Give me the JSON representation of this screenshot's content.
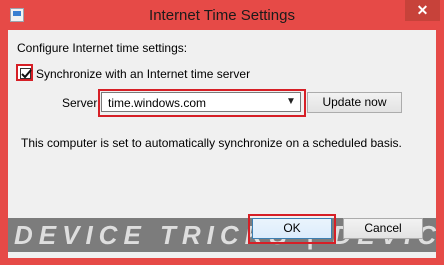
{
  "window": {
    "title": "Internet Time Settings",
    "close_glyph": "✕",
    "icon": "control-panel-icon"
  },
  "content": {
    "configure_label": "Configure Internet time settings:",
    "sync_checkbox": {
      "label": "Synchronize with an Internet time server",
      "checked": true
    },
    "server_label": "Server:",
    "server_value": "time.windows.com",
    "update_button": "Update now",
    "status_text": "This computer is set to automatically synchronize on a scheduled basis."
  },
  "buttons": {
    "ok": "OK",
    "cancel": "Cancel"
  },
  "watermark": {
    "text": "DEVICE TRICKS | DEVICE TR"
  },
  "colors": {
    "frame": "#e64a47",
    "highlight": "#d61f26",
    "client": "#f0f0f0"
  }
}
